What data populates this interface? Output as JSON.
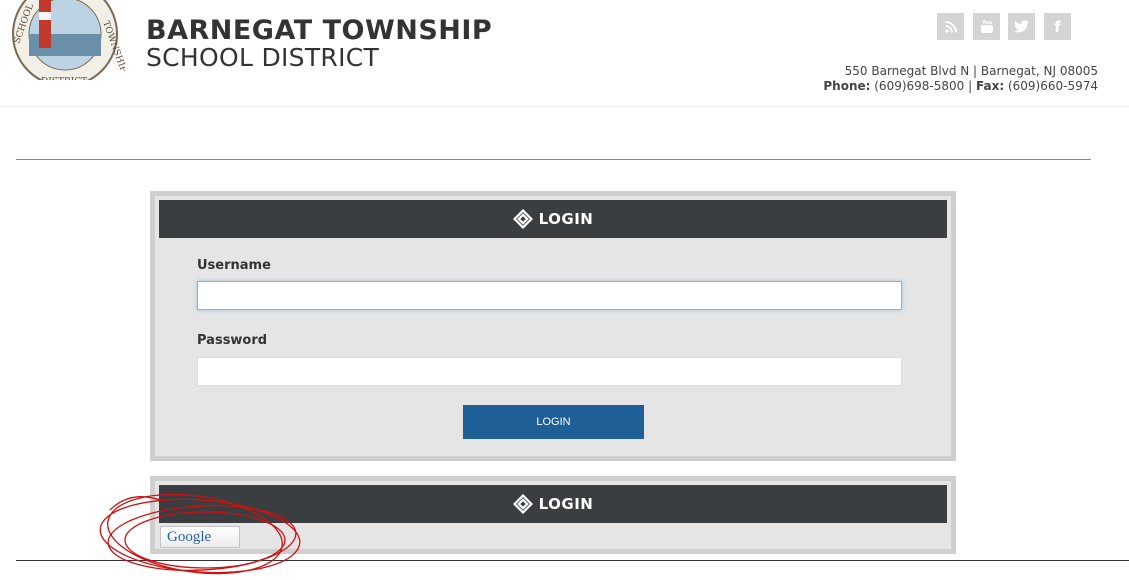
{
  "header": {
    "title_line1": "BARNEGAT TOWNSHIP",
    "title_line2": "SCHOOL DISTRICT",
    "logo_text": [
      "SCHOOL",
      "DISTRICT",
      "TOWNSHIP",
      "GAT"
    ],
    "address": "550 Barnegat Blvd N | Barnegat, NJ 08005",
    "phone_label": "Phone:",
    "phone": "(609)698-5800",
    "fax_label": "Fax:",
    "fax": "(609)660-5974",
    "social": [
      {
        "icon": "rss-icon",
        "glyph": "❝"
      },
      {
        "icon": "youtube-icon",
        "glyph": "▶"
      },
      {
        "icon": "twitter-icon",
        "glyph": "❧"
      },
      {
        "icon": "facebook-icon",
        "glyph": "f"
      }
    ]
  },
  "login_panel": {
    "title": "LOGIN",
    "username_label": "Username",
    "username_value": "",
    "password_label": "Password",
    "password_value": "",
    "button_label": "LOGIN"
  },
  "sso_panel": {
    "title": "LOGIN",
    "google_label": "Google"
  },
  "colors": {
    "panel_header": "#3b3e40",
    "button": "#1f5f97",
    "annotation": "#cc1111"
  }
}
